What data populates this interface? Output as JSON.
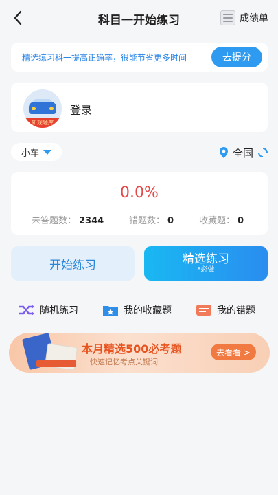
{
  "header": {
    "back_icon": "chevron-left-icon",
    "title": "科目一开始练习",
    "score_label": "成绩单",
    "score_icon": "report-icon"
  },
  "banner": {
    "text": "精选练习科一提高正确率，很能节省更多时间",
    "button_label": "去提分"
  },
  "login": {
    "label": "登录",
    "avatar_ribbon": "新规题库"
  },
  "filters": {
    "car_type": "小车",
    "region": "全国"
  },
  "stats": {
    "accuracy": "0.0%",
    "unanswered_label": "未答题数：",
    "unanswered_value": "2344",
    "wrong_label": "错题数：",
    "wrong_value": "0",
    "favorites_label": "收藏题：",
    "favorites_value": "0"
  },
  "actions": {
    "start_label": "开始练习",
    "select_label": "精选练习",
    "select_sub": "*必做"
  },
  "quick_links": [
    {
      "label": "随机练习",
      "icon": "shuffle-icon"
    },
    {
      "label": "我的收藏题",
      "icon": "star-folder-icon"
    },
    {
      "label": "我的错题",
      "icon": "wrong-book-icon"
    }
  ],
  "promo": {
    "title": "本月精选500必考题",
    "subtitle": "快速记忆考点关键词",
    "button_label": "去看看 >"
  },
  "colors": {
    "accent": "#2f9bf0",
    "accuracy": "#e34b4b",
    "promo_title": "#e7531f"
  }
}
